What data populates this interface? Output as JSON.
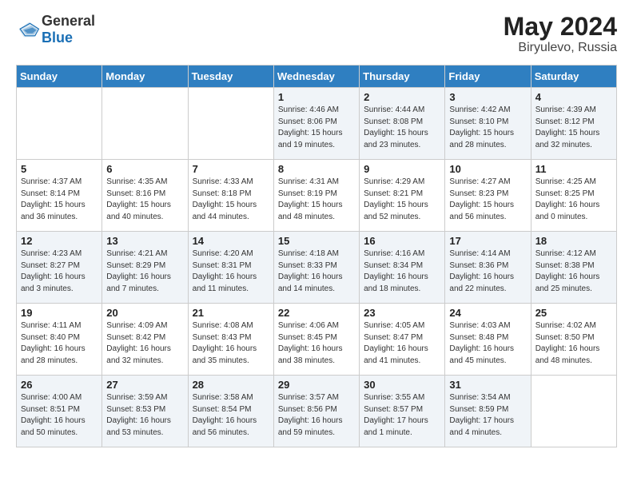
{
  "header": {
    "logo_general": "General",
    "logo_blue": "Blue",
    "month_year": "May 2024",
    "location": "Biryulevo, Russia"
  },
  "weekdays": [
    "Sunday",
    "Monday",
    "Tuesday",
    "Wednesday",
    "Thursday",
    "Friday",
    "Saturday"
  ],
  "weeks": [
    [
      {
        "day": "",
        "sunrise": "",
        "sunset": "",
        "daylight": ""
      },
      {
        "day": "",
        "sunrise": "",
        "sunset": "",
        "daylight": ""
      },
      {
        "day": "",
        "sunrise": "",
        "sunset": "",
        "daylight": ""
      },
      {
        "day": "1",
        "sunrise": "Sunrise: 4:46 AM",
        "sunset": "Sunset: 8:06 PM",
        "daylight": "Daylight: 15 hours and 19 minutes."
      },
      {
        "day": "2",
        "sunrise": "Sunrise: 4:44 AM",
        "sunset": "Sunset: 8:08 PM",
        "daylight": "Daylight: 15 hours and 23 minutes."
      },
      {
        "day": "3",
        "sunrise": "Sunrise: 4:42 AM",
        "sunset": "Sunset: 8:10 PM",
        "daylight": "Daylight: 15 hours and 28 minutes."
      },
      {
        "day": "4",
        "sunrise": "Sunrise: 4:39 AM",
        "sunset": "Sunset: 8:12 PM",
        "daylight": "Daylight: 15 hours and 32 minutes."
      }
    ],
    [
      {
        "day": "5",
        "sunrise": "Sunrise: 4:37 AM",
        "sunset": "Sunset: 8:14 PM",
        "daylight": "Daylight: 15 hours and 36 minutes."
      },
      {
        "day": "6",
        "sunrise": "Sunrise: 4:35 AM",
        "sunset": "Sunset: 8:16 PM",
        "daylight": "Daylight: 15 hours and 40 minutes."
      },
      {
        "day": "7",
        "sunrise": "Sunrise: 4:33 AM",
        "sunset": "Sunset: 8:18 PM",
        "daylight": "Daylight: 15 hours and 44 minutes."
      },
      {
        "day": "8",
        "sunrise": "Sunrise: 4:31 AM",
        "sunset": "Sunset: 8:19 PM",
        "daylight": "Daylight: 15 hours and 48 minutes."
      },
      {
        "day": "9",
        "sunrise": "Sunrise: 4:29 AM",
        "sunset": "Sunset: 8:21 PM",
        "daylight": "Daylight: 15 hours and 52 minutes."
      },
      {
        "day": "10",
        "sunrise": "Sunrise: 4:27 AM",
        "sunset": "Sunset: 8:23 PM",
        "daylight": "Daylight: 15 hours and 56 minutes."
      },
      {
        "day": "11",
        "sunrise": "Sunrise: 4:25 AM",
        "sunset": "Sunset: 8:25 PM",
        "daylight": "Daylight: 16 hours and 0 minutes."
      }
    ],
    [
      {
        "day": "12",
        "sunrise": "Sunrise: 4:23 AM",
        "sunset": "Sunset: 8:27 PM",
        "daylight": "Daylight: 16 hours and 3 minutes."
      },
      {
        "day": "13",
        "sunrise": "Sunrise: 4:21 AM",
        "sunset": "Sunset: 8:29 PM",
        "daylight": "Daylight: 16 hours and 7 minutes."
      },
      {
        "day": "14",
        "sunrise": "Sunrise: 4:20 AM",
        "sunset": "Sunset: 8:31 PM",
        "daylight": "Daylight: 16 hours and 11 minutes."
      },
      {
        "day": "15",
        "sunrise": "Sunrise: 4:18 AM",
        "sunset": "Sunset: 8:33 PM",
        "daylight": "Daylight: 16 hours and 14 minutes."
      },
      {
        "day": "16",
        "sunrise": "Sunrise: 4:16 AM",
        "sunset": "Sunset: 8:34 PM",
        "daylight": "Daylight: 16 hours and 18 minutes."
      },
      {
        "day": "17",
        "sunrise": "Sunrise: 4:14 AM",
        "sunset": "Sunset: 8:36 PM",
        "daylight": "Daylight: 16 hours and 22 minutes."
      },
      {
        "day": "18",
        "sunrise": "Sunrise: 4:12 AM",
        "sunset": "Sunset: 8:38 PM",
        "daylight": "Daylight: 16 hours and 25 minutes."
      }
    ],
    [
      {
        "day": "19",
        "sunrise": "Sunrise: 4:11 AM",
        "sunset": "Sunset: 8:40 PM",
        "daylight": "Daylight: 16 hours and 28 minutes."
      },
      {
        "day": "20",
        "sunrise": "Sunrise: 4:09 AM",
        "sunset": "Sunset: 8:42 PM",
        "daylight": "Daylight: 16 hours and 32 minutes."
      },
      {
        "day": "21",
        "sunrise": "Sunrise: 4:08 AM",
        "sunset": "Sunset: 8:43 PM",
        "daylight": "Daylight: 16 hours and 35 minutes."
      },
      {
        "day": "22",
        "sunrise": "Sunrise: 4:06 AM",
        "sunset": "Sunset: 8:45 PM",
        "daylight": "Daylight: 16 hours and 38 minutes."
      },
      {
        "day": "23",
        "sunrise": "Sunrise: 4:05 AM",
        "sunset": "Sunset: 8:47 PM",
        "daylight": "Daylight: 16 hours and 41 minutes."
      },
      {
        "day": "24",
        "sunrise": "Sunrise: 4:03 AM",
        "sunset": "Sunset: 8:48 PM",
        "daylight": "Daylight: 16 hours and 45 minutes."
      },
      {
        "day": "25",
        "sunrise": "Sunrise: 4:02 AM",
        "sunset": "Sunset: 8:50 PM",
        "daylight": "Daylight: 16 hours and 48 minutes."
      }
    ],
    [
      {
        "day": "26",
        "sunrise": "Sunrise: 4:00 AM",
        "sunset": "Sunset: 8:51 PM",
        "daylight": "Daylight: 16 hours and 50 minutes."
      },
      {
        "day": "27",
        "sunrise": "Sunrise: 3:59 AM",
        "sunset": "Sunset: 8:53 PM",
        "daylight": "Daylight: 16 hours and 53 minutes."
      },
      {
        "day": "28",
        "sunrise": "Sunrise: 3:58 AM",
        "sunset": "Sunset: 8:54 PM",
        "daylight": "Daylight: 16 hours and 56 minutes."
      },
      {
        "day": "29",
        "sunrise": "Sunrise: 3:57 AM",
        "sunset": "Sunset: 8:56 PM",
        "daylight": "Daylight: 16 hours and 59 minutes."
      },
      {
        "day": "30",
        "sunrise": "Sunrise: 3:55 AM",
        "sunset": "Sunset: 8:57 PM",
        "daylight": "Daylight: 17 hours and 1 minute."
      },
      {
        "day": "31",
        "sunrise": "Sunrise: 3:54 AM",
        "sunset": "Sunset: 8:59 PM",
        "daylight": "Daylight: 17 hours and 4 minutes."
      },
      {
        "day": "",
        "sunrise": "",
        "sunset": "",
        "daylight": ""
      }
    ]
  ]
}
